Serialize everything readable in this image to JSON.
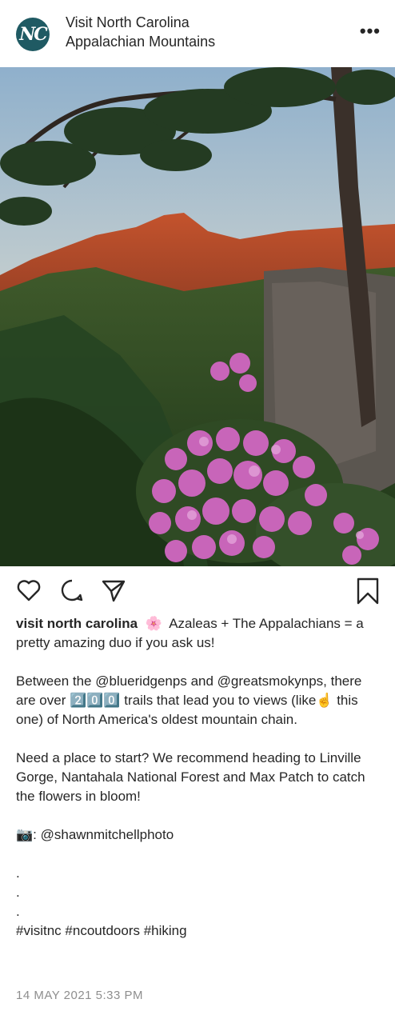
{
  "post": {
    "avatar_text": "NC",
    "account_name": "Visit North Carolina",
    "location": "Appalachian Mountains",
    "more_label": "•••",
    "caption_user": "visit north carolina",
    "caption_body": "  🌸  Azaleas + The Appalachians = a pretty amazing duo if you ask us!\n\nBetween the @blueridgenps and @greatsmokynps, there are over 2️⃣0️⃣0️⃣ trails that lead you to views (like☝️ this one) of North America's oldest mountain chain.\n\nNeed a place to start? We recommend heading to Linville Gorge, Nantahala National Forest and Max Patch to catch the flowers in bloom!\n\n📷: @shawnmitchellphoto\n\n.\n.\n.\n#visitnc #ncoutdoors #hiking",
    "timestamp": "14 MAY 2021 5:33 PM"
  },
  "icons": {
    "like": "heart-icon",
    "comment": "comment-bubble-icon",
    "share": "paper-plane-icon",
    "save": "bookmark-icon"
  },
  "colors": {
    "avatar_bg": "#1f5a63",
    "text": "#262626",
    "muted": "#8e8e8e"
  }
}
